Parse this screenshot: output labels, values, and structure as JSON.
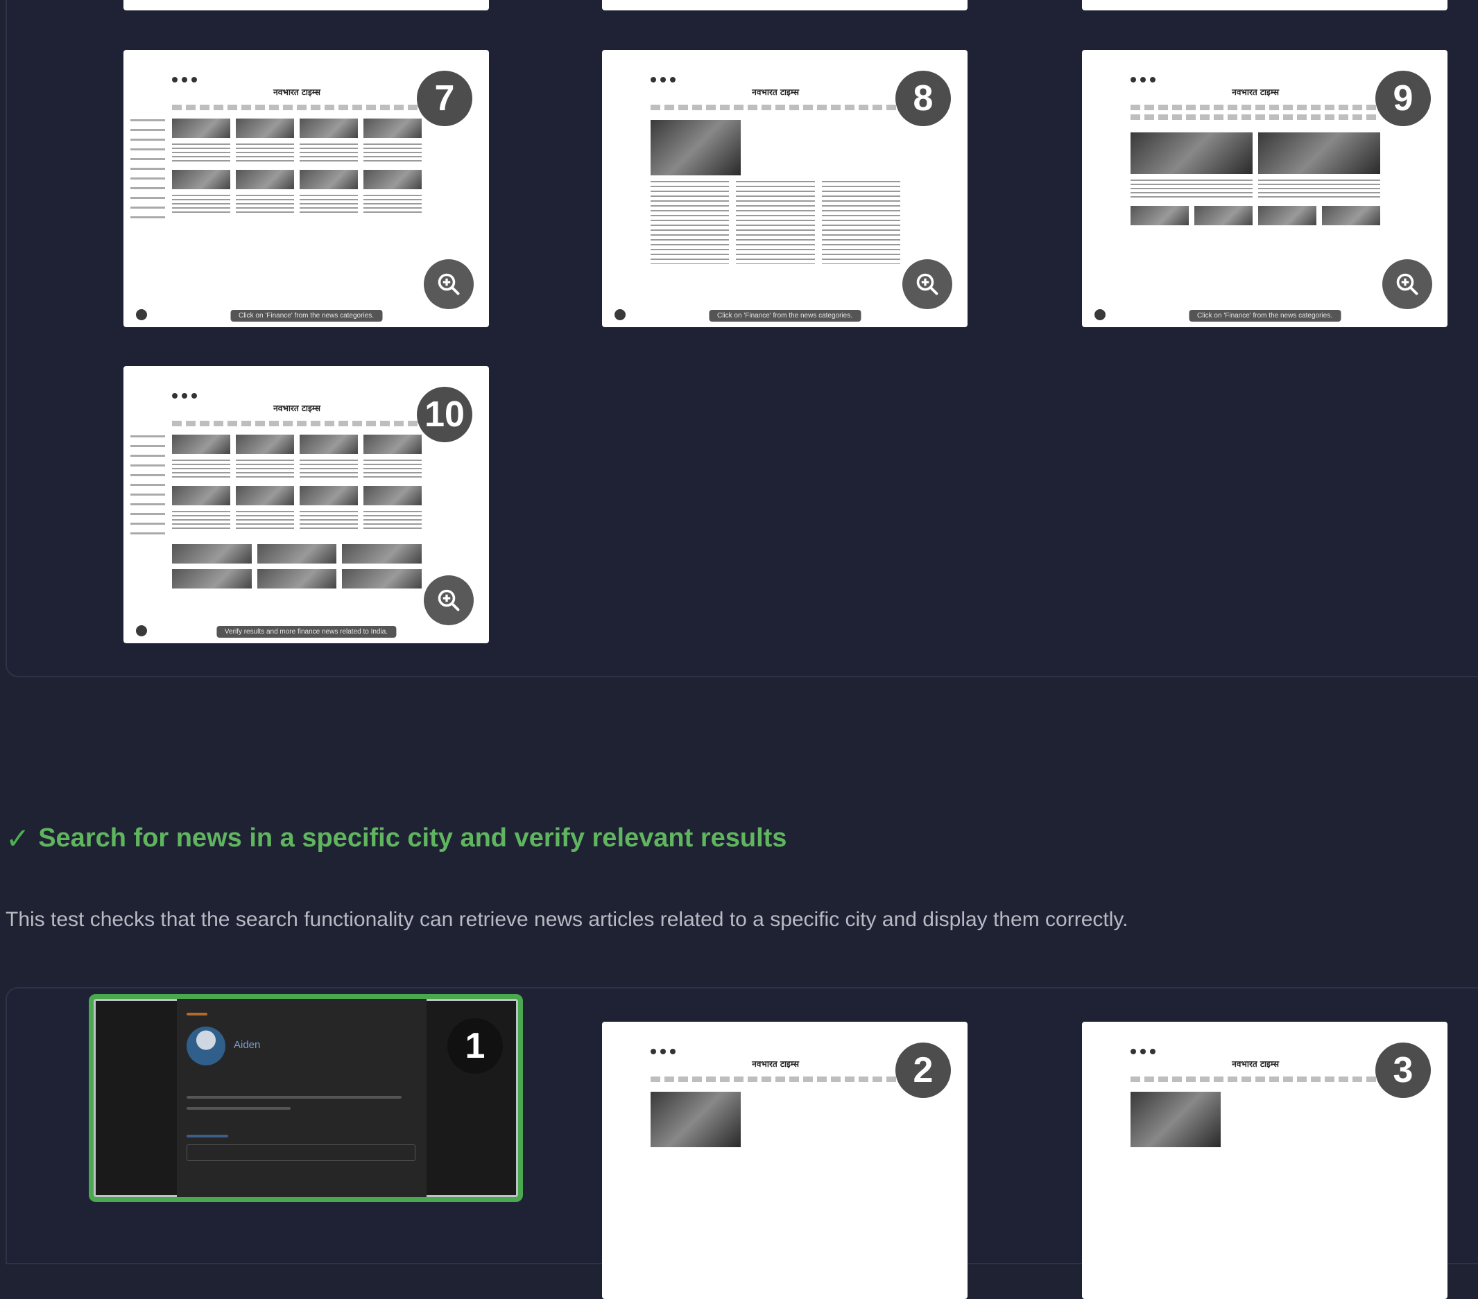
{
  "gallery_top": {
    "thumbnails": [
      {
        "number": "7",
        "caption": "Click on 'Finance' from the news categories."
      },
      {
        "number": "8",
        "caption": "Click on 'Finance' from the news categories."
      },
      {
        "number": "9",
        "caption": "Click on 'Finance' from the news categories."
      },
      {
        "number": "10",
        "caption": "Verify results and more finance news related to India."
      }
    ]
  },
  "test": {
    "status_icon": "check-icon",
    "check_glyph": "✓",
    "title": "Search for news in a specific city and verify relevant results",
    "description": "This test checks that the search functionality can retrieve news articles related to a specific city and display them correctly.",
    "colors": {
      "success": "#5fb65f",
      "background": "#1f2233",
      "badge": "#4d4d4d",
      "active_border": "#4aa84f"
    }
  },
  "gallery_bottom": {
    "thumbnails": [
      {
        "number": "1",
        "active": true,
        "user_name": "Aiden"
      },
      {
        "number": "2"
      },
      {
        "number": "3"
      }
    ]
  }
}
